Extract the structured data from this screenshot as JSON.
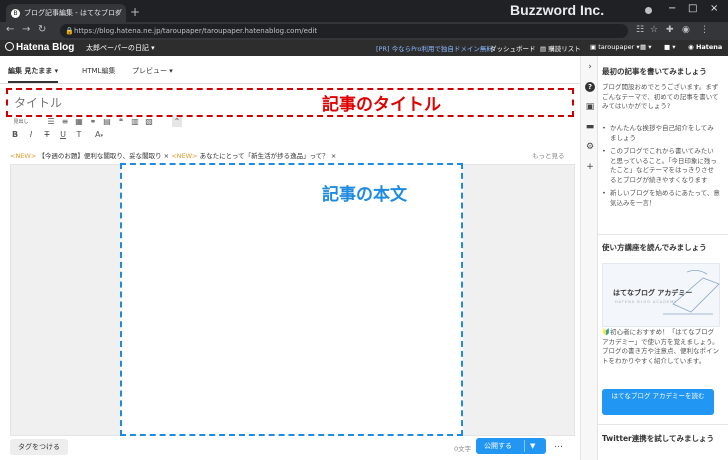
{
  "browser": {
    "tab_title": "ブログ記事編集 - はてなブログ",
    "tab_close": "×",
    "new_tab": "+",
    "brand": "Buzzword Inc.",
    "minimize": "−",
    "maximize": "□",
    "close": "×",
    "url": "https://blog.hatena.ne.jp/taroupaper/taroupaper.hatenablog.com/edit"
  },
  "header": {
    "logo": "Hatena Blog",
    "blog_name": "太郎ペーパーの日記",
    "promo": "[PR] 今ならPro利用で独自ドメイン無料",
    "dashboard": "ダッシュボード",
    "subscriptions": "購読リスト",
    "user": "taroupaper",
    "hatena": "Hatena"
  },
  "editor": {
    "tabs": [
      "編集 見たまま",
      "HTML編集",
      "プレビュー"
    ],
    "title_placeholder": "タイトル",
    "title_annotation": "記事のタイトル",
    "paragraph_style": "見出し",
    "notice_new_1": "<NEW>",
    "notice_text_1": "【今週のお題】便利な閣取り、妥な閣取り ×",
    "notice_new_2": "<NEW>",
    "notice_text_2": "あなたにとって「新生活が捗る逸品」って？ ×",
    "more": "もっと見る",
    "body_annotation": "記事の本文",
    "tag_button": "タグをつける",
    "char_count": "0文字",
    "publish_button": "公開する",
    "more_options": "…"
  },
  "sidebar": {
    "heading1": "最初の記事を書いてみましょう",
    "intro": "ブログ開設おめでとうございます。まずごんなテーマで、初めての記事を書いてみてはいかがでしょう?",
    "tips": [
      "かんたんな挨拶や自己紹介をしてみましょう",
      "このブログでこれから書いてみたいと思っていること。「今日印象に残ったこと」などテーマをはっきりさせるとブログが続きやすくなります",
      "新しいブログを始めるにあたって、意気込みを一言！"
    ],
    "heading2": "使い方講座を読んでみましょう",
    "banner_title": "はてなブログ アカデミー",
    "banner_subtitle": "HATENA BLOG ACADEMY",
    "academy_text": "🔰初心者におすすめ！「はてなブログ アカデミー」で使い方を覚えましょう。ブログの書き方や注意点、便利なポイントをわかりやすく紹介しています。",
    "academy_button": "はてなブログ アカデミーを読む",
    "heading3": "Twitter連携を試してみましょう"
  }
}
